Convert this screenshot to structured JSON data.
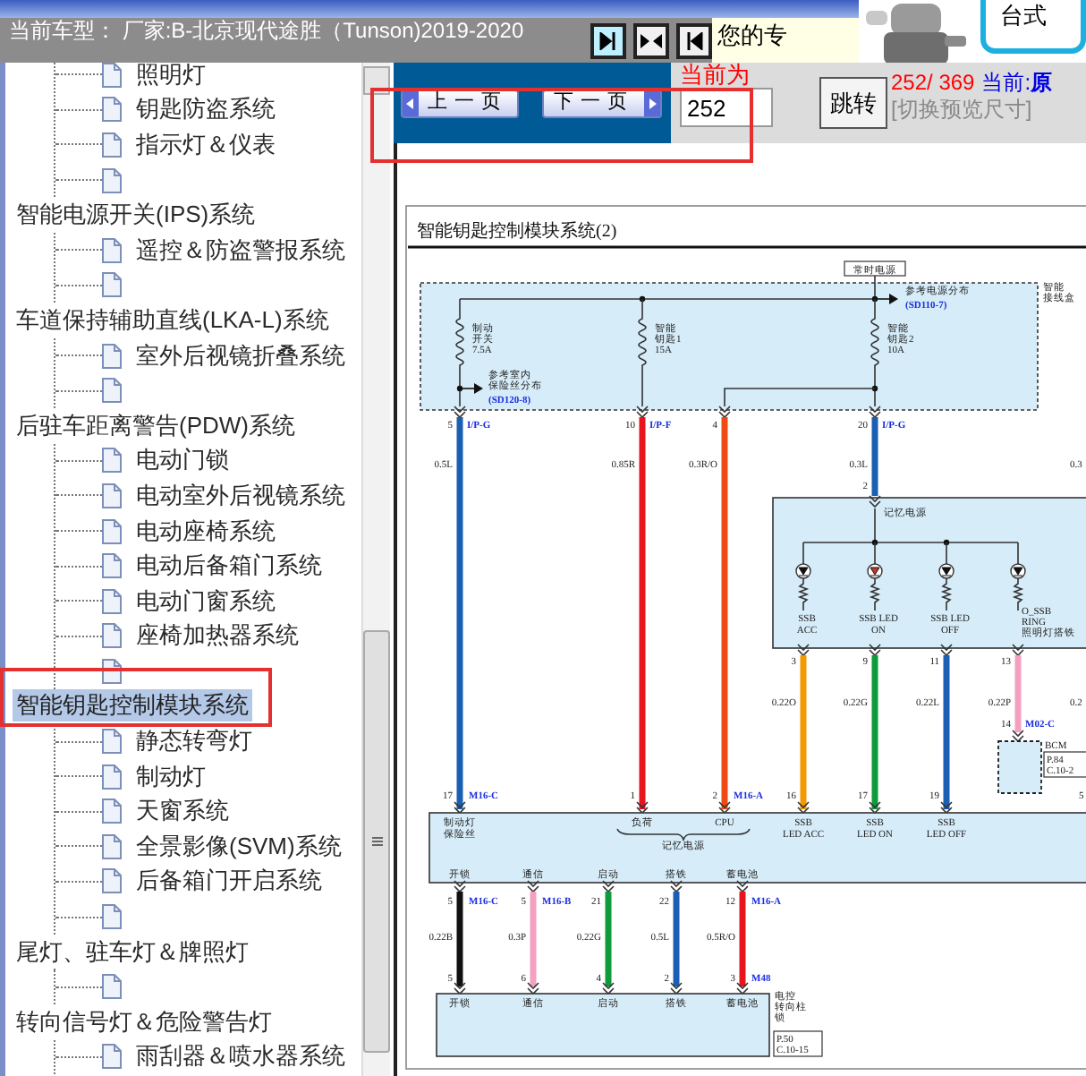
{
  "header": {
    "vehicle": "当前车型： 厂家:B-北京现代途胜（Tunson)2019-2020",
    "notice": "您的专",
    "corner": "台式"
  },
  "toolbar": {
    "prev": "上一页",
    "next": "下一页",
    "page_label": "当前为",
    "page_input": "252",
    "go": "跳转",
    "page_count": "252/ 369",
    "current_label": "当前:",
    "current_value": "原",
    "preview_toggle": "[切换预览尺寸]"
  },
  "tree": [
    {
      "children": [
        {
          "label": "照明灯",
          "selected": false
        },
        {
          "label": "钥匙防盗系统",
          "selected": false
        },
        {
          "label": "指示灯＆仪表",
          "selected": false
        },
        {
          "kind": "blank"
        }
      ]
    },
    {
      "label": "智能电源开关(IPS)系统",
      "selected": false,
      "children": [
        {
          "label": "遥控＆防盗警报系统",
          "selected": false
        },
        {
          "kind": "blank"
        }
      ]
    },
    {
      "label": "车道保持辅助直线(LKA-L)系统",
      "selected": false,
      "children": [
        {
          "label": "室外后视镜折叠系统",
          "selected": false
        },
        {
          "kind": "blank"
        }
      ]
    },
    {
      "label": "后驻车距离警告(PDW)系统",
      "selected": false,
      "children": [
        {
          "label": "电动门锁",
          "selected": false
        },
        {
          "label": "电动室外后视镜系统",
          "selected": false
        },
        {
          "label": "电动座椅系统",
          "selected": false
        },
        {
          "label": "电动后备箱门系统",
          "selected": false
        },
        {
          "label": "电动门窗系统",
          "selected": false
        },
        {
          "label": "座椅加热器系统",
          "selected": false
        },
        {
          "kind": "blank"
        }
      ]
    },
    {
      "label": "智能钥匙控制模块系统",
      "selected": true,
      "children": [
        {
          "label": "静态转弯灯",
          "selected": false
        },
        {
          "label": "制动灯",
          "selected": false
        },
        {
          "label": "天窗系统",
          "selected": false
        },
        {
          "label": "全景影像(SVM)系统",
          "selected": false
        },
        {
          "label": "后备箱门开启系统",
          "selected": false
        },
        {
          "kind": "blank"
        }
      ]
    },
    {
      "label": "尾灯、驻车灯＆牌照灯",
      "selected": false,
      "children": [
        {
          "kind": "blank"
        }
      ]
    },
    {
      "label": "转向信号灯＆危险警告灯",
      "selected": false,
      "children": [
        {
          "label": "雨刮器＆喷水器系统",
          "selected": false
        }
      ]
    }
  ],
  "diagram": {
    "title": "智能钥匙控制模块系统(2)",
    "power_label": "常时电源",
    "junction_box": [
      "智能",
      "接线盒"
    ],
    "power_ref": {
      "text": "参考电源分布",
      "code": "(SD110-7)"
    },
    "fuse_ref": {
      "lines": [
        "参考室内",
        "保险丝分布"
      ],
      "code": "(SD120-8)"
    },
    "fuses": [
      {
        "lines": [
          "制动",
          "开关"
        ],
        "rating": "7.5A"
      },
      {
        "lines": [
          "智能",
          "钥匙1"
        ],
        "rating": "15A"
      },
      {
        "lines": [
          "智能",
          "钥匙2"
        ],
        "rating": "10A"
      }
    ],
    "upper_wires": [
      {
        "pin": "5",
        "connector": "I/P-G",
        "spec": "0.5L",
        "color": "#1a5fb4",
        "end_pin": "17",
        "end_connector": "M16-C"
      },
      {
        "pin": "10",
        "connector": "I/P-F",
        "spec": "0.85R",
        "color": "#e8141e",
        "end_pin": "1"
      },
      {
        "pin": "4",
        "spec": "0.3R/O",
        "color": "#ee4a14",
        "end_pin": "2",
        "end_connector": "M16-A"
      },
      {
        "pin": "20",
        "connector": "I/P-G",
        "spec": "0.3L",
        "color": "#1a5fb4",
        "end_pin": "2"
      }
    ],
    "ssb_label": "记忆电源",
    "ssb_leds": [
      {
        "lines": [
          "SSB",
          "ACC"
        ],
        "pin": "3",
        "spec": "0.22O",
        "color": "#f39a00",
        "end_pin": "16"
      },
      {
        "lines": [
          "SSB LED",
          "ON"
        ],
        "pin": "9",
        "spec": "0.22G",
        "color": "#0f9a3c",
        "end_pin": "17"
      },
      {
        "lines": [
          "SSB LED",
          "OFF"
        ],
        "pin": "11",
        "spec": "0.22L",
        "color": "#1a5fb4",
        "end_pin": "19"
      },
      {
        "lines": [
          "O_SSB",
          "RING",
          "照明灯搭铁"
        ],
        "pin": "13",
        "spec": "0.22P",
        "color": "#f4a0c0",
        "end_pin": "14",
        "end_connector": "M02-C"
      }
    ],
    "bcm": {
      "name": "BCM",
      "refs": [
        "P.84",
        "C.10-2"
      ]
    },
    "edge_specs": [
      "0.3",
      "0.2"
    ],
    "module": {
      "labels": [
        {
          "lines": [
            "制动灯",
            "保险丝"
          ]
        },
        {
          "lines": [
            "负荷"
          ]
        },
        {
          "lines": [
            "CPU"
          ]
        },
        {
          "lines": [
            "SSB",
            "LED ACC"
          ]
        },
        {
          "lines": [
            "SSB",
            "LED ON"
          ]
        },
        {
          "lines": [
            "SSB",
            "LED OFF"
          ]
        }
      ],
      "group_label": "记忆电源",
      "edge_pin": "5"
    },
    "lower_wires": [
      {
        "label": "开锁",
        "pin": "5",
        "connector": "M16-C",
        "spec": "0.22B",
        "color": "#111111",
        "end_pin": "5",
        "end_label": "开锁"
      },
      {
        "label": "通信",
        "pin": "5",
        "connector": "M16-B",
        "spec": "0.3P",
        "color": "#f4a0c0",
        "end_pin": "6",
        "end_label": "通信"
      },
      {
        "label": "启动",
        "pin": "21",
        "spec": "0.22G",
        "color": "#0f9a3c",
        "end_pin": "4",
        "end_label": "启动"
      },
      {
        "label": "搭铁",
        "pin": "22",
        "spec": "0.5L",
        "color": "#1a5fb4",
        "end_pin": "2",
        "end_label": "搭铁"
      },
      {
        "label": "蓄电池",
        "pin": "12",
        "connector": "M16-A",
        "spec": "0.5R/O",
        "color": "#e8141e",
        "end_pin": "3",
        "end_label": "蓄电池"
      }
    ],
    "lower_end_connector": "M48",
    "lock": {
      "lines": [
        "电控",
        "转向柱",
        "锁"
      ],
      "refs": [
        "P.50",
        "C.10-15"
      ]
    }
  }
}
